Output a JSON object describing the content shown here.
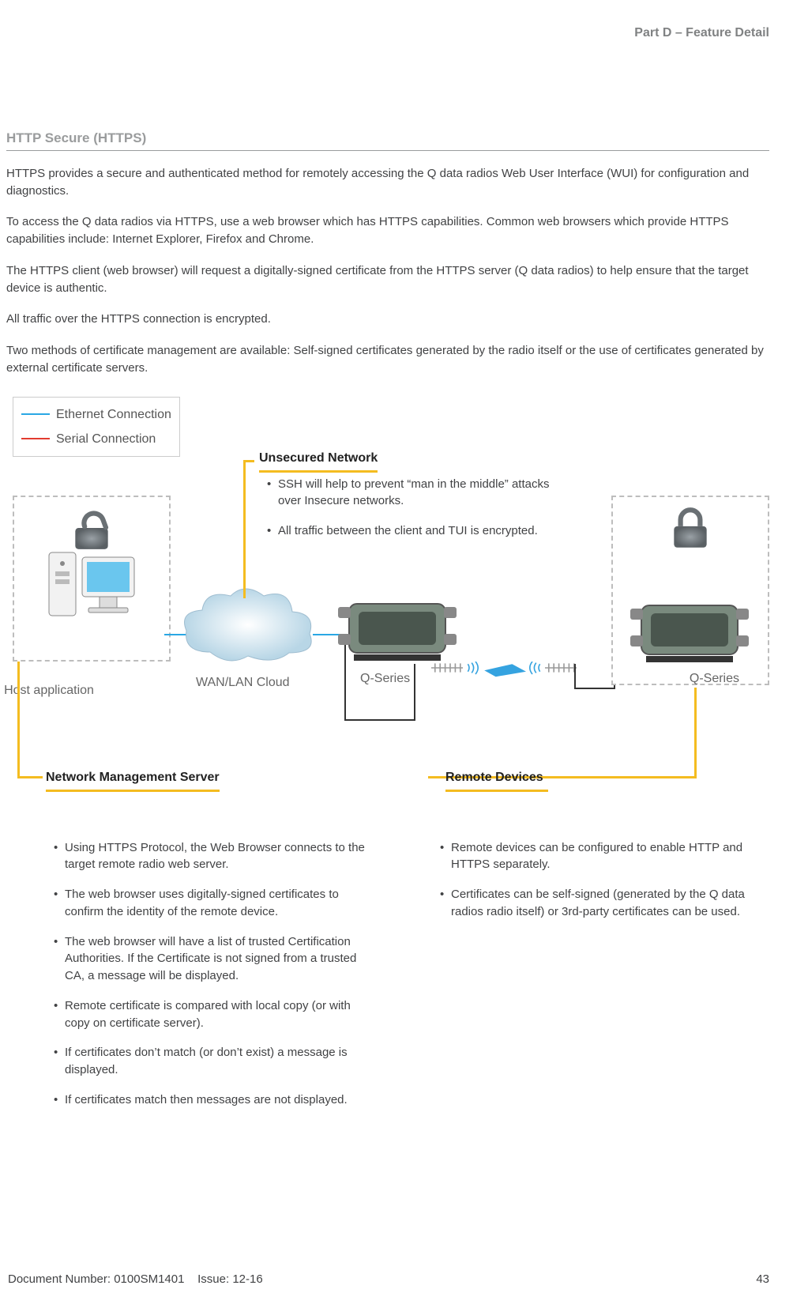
{
  "header": {
    "part": "Part D – Feature Detail"
  },
  "section_title": "HTTP Secure (HTTPS)",
  "paragraphs": [
    "HTTPS provides a secure and authenticated method for remotely accessing the Q data radios Web User Interface (WUI) for configuration and diagnostics.",
    "To access the Q data radios via HTTPS, use a web browser which has HTTPS capabilities. Common web browsers which provide HTTPS capabilities include: Internet Explorer, Firefox and Chrome.",
    "The HTTPS client (web browser) will request a digitally-signed certificate from the HTTPS server (Q data radios) to help ensure that the target device is authentic.",
    "All traffic over the HTTPS connection is encrypted.",
    "Two methods of certificate management are available: Self-signed certificates generated by the radio itself or the use of certificates generated by external certificate servers."
  ],
  "legend": {
    "eth": "Ethernet Connection",
    "ser": "Serial Connection"
  },
  "diagram_labels": {
    "host": "Host application",
    "cloud": "WAN/LAN Cloud",
    "q1": "Q-Series",
    "q2": "Q-Series"
  },
  "callouts": {
    "unsecured": {
      "title": "Unsecured Network",
      "bullets": [
        "SSH will help to prevent “man in the middle” attacks over Insecure networks.",
        "All traffic between the client and TUI is encrypted."
      ]
    },
    "nms": {
      "title": "Network Management Server",
      "bullets": [
        "Using HTTPS Protocol, the Web Browser connects to the target remote radio web server.",
        "The web browser uses digitally-signed certificates to confirm the identity of the remote device.",
        "The web browser will have a list of trusted Certification Authorities. If the Certificate is not signed from a trusted CA, a message will be displayed.",
        "Remote certificate is compared with local copy (or with copy on certificate server).",
        "If certificates don’t match (or don’t exist) a message is displayed.",
        "If certificates match then messages are not displayed."
      ]
    },
    "remote": {
      "title": "Remote Devices",
      "bullets": [
        "Remote devices can be configured to enable HTTP and HTTPS separately.",
        "Certificates can be self-signed (generated by the  Q data radios radio itself) or 3rd-party certificates can be used."
      ]
    }
  },
  "footer": {
    "doc": "Document Number: 0100SM1401",
    "issue": "Issue: 12-16",
    "page": "43"
  }
}
